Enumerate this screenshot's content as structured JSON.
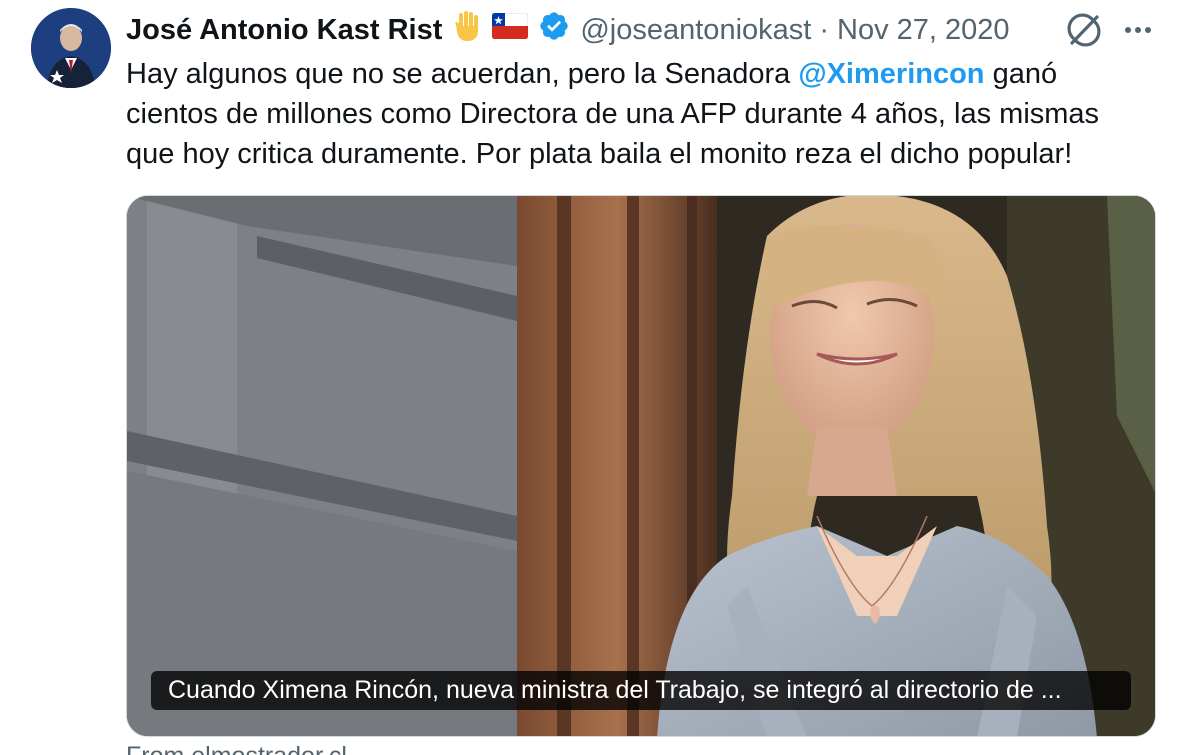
{
  "tweet": {
    "author_name": "José Antonio Kast Rist",
    "author_handle": "@joseantoniokast",
    "separator": "·",
    "date": "Nov 27, 2020",
    "badges": {
      "hand_emoji": "raised-hand-icon",
      "flag_emoji": "chile-flag-icon",
      "verified": "verified-badge-icon"
    },
    "text": {
      "line1_before": "Hay algunos que no se acuerdan, pero la Senadora ",
      "mention": "@Ximerincon",
      "line1_after": " ganó",
      "line2": "cientos de millones como Directora de una AFP durante 4 años, las mismas",
      "line3": "que hoy critica duramente. Por plata baila el monito reza el dicho popular!"
    },
    "card": {
      "caption": "Cuando Ximena Rincón, nueva ministra del Trabajo, se integró al directorio de ...",
      "source": "From elmostrador.cl"
    }
  },
  "colors": {
    "text": "#0f1419",
    "secondary": "#536471",
    "link": "#1d9bf0",
    "verified": "#1d9bf0"
  }
}
